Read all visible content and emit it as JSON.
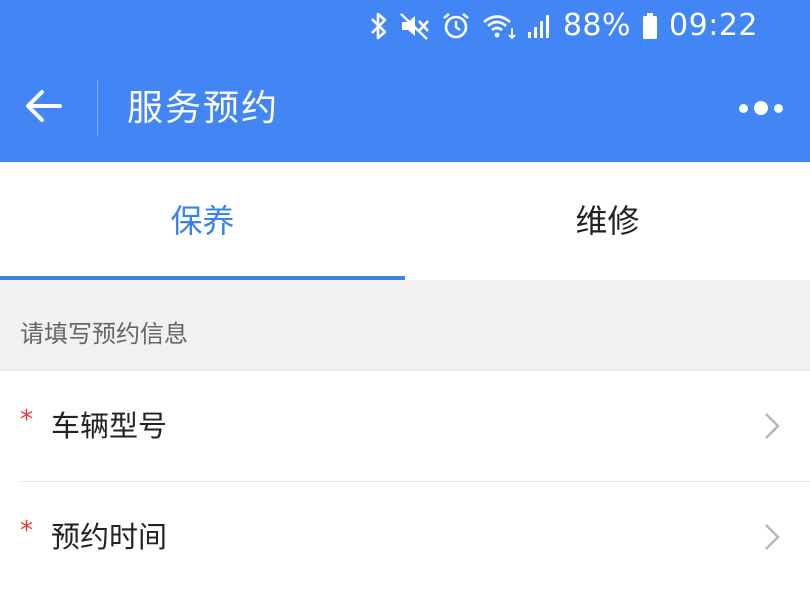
{
  "status_bar": {
    "battery_percent": "88%",
    "time": "09:22",
    "icons": [
      "bluetooth-icon",
      "mute-icon",
      "alarm-icon",
      "wifi-icon",
      "signal-icon",
      "battery-icon"
    ]
  },
  "toolbar": {
    "title": "服务预约",
    "back_icon": "arrow-left-icon",
    "more_icon": "more-dots-icon"
  },
  "tabs": [
    {
      "label": "保养",
      "active": true
    },
    {
      "label": "维修",
      "active": false
    }
  ],
  "form": {
    "section_title": "请填写预约信息",
    "required_mark": "*",
    "fields": [
      {
        "label": "车辆型号",
        "required": true
      },
      {
        "label": "预约时间",
        "required": true
      }
    ]
  },
  "colors": {
    "primary": "#4285f4",
    "tab_active": "#3b82e8",
    "required": "#e53935",
    "section_bg": "#f1f1f4"
  }
}
